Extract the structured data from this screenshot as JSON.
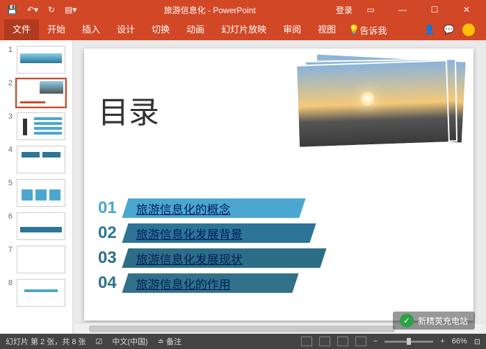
{
  "titlebar": {
    "doc_name": "旅游信息化",
    "app_name": "PowerPoint",
    "login": "登录"
  },
  "ribbon": {
    "tabs": [
      "文件",
      "开始",
      "插入",
      "设计",
      "切换",
      "动画",
      "幻灯片放映",
      "审阅",
      "视图"
    ],
    "tell_me": "告诉我"
  },
  "thumbnails": [
    "1",
    "2",
    "3",
    "4",
    "5",
    "6",
    "7",
    "8"
  ],
  "slide": {
    "title": "目录",
    "toc": [
      {
        "num": "01",
        "text": "旅游信息化的概念"
      },
      {
        "num": "02",
        "text": "旅游信息化发展背景"
      },
      {
        "num": "03",
        "text": "旅游信息化发展现状"
      },
      {
        "num": "04",
        "text": "旅游信息化的作用"
      }
    ]
  },
  "statusbar": {
    "slide_pos": "幻灯片 第 2 张，共 8 张",
    "lang": "中文(中国)",
    "notes": "备注",
    "zoom_pct": "66%"
  },
  "watermark": "新精英充电站"
}
